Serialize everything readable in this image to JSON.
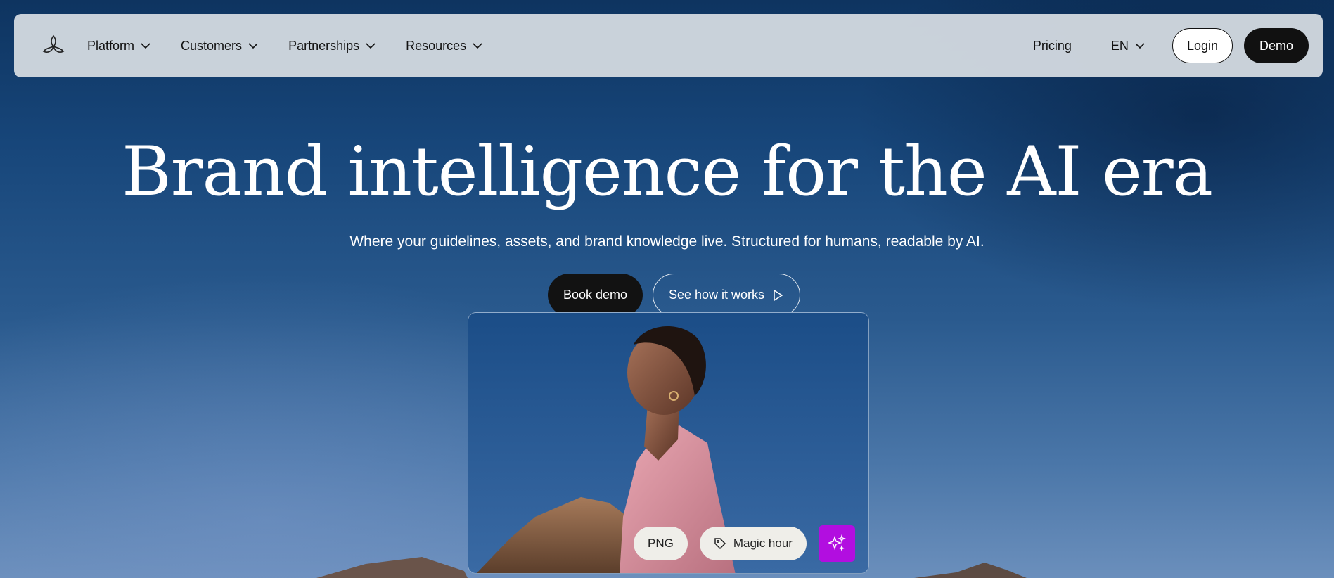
{
  "nav": {
    "logo_icon": "tri-petal-logo-icon",
    "items": [
      {
        "label": "Platform"
      },
      {
        "label": "Customers"
      },
      {
        "label": "Partnerships"
      },
      {
        "label": "Resources"
      }
    ],
    "pricing_label": "Pricing",
    "language_label": "EN",
    "login_label": "Login",
    "demo_label": "Demo"
  },
  "hero": {
    "title": "Brand intelligence for the AI era",
    "subtitle": "Where your guidelines, assets, and brand knowledge live. Structured for humans, readable by AI.",
    "book_demo_label": "Book demo",
    "see_how_label": "See how it works"
  },
  "preview": {
    "format_chip": "PNG",
    "tag_chip": "Magic hour",
    "tag_icon": "tag-icon",
    "ai_button_icon": "sparkle-icon",
    "accent_color": "#b20ee0"
  }
}
